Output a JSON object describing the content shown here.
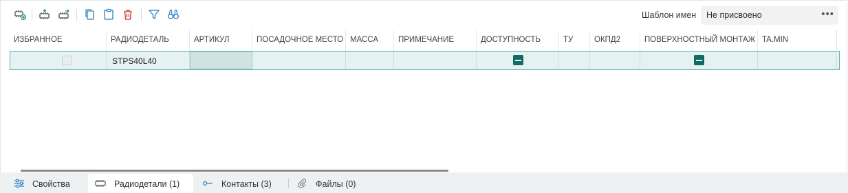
{
  "toolbar": {
    "icons": [
      "add-component-icon",
      "component-import-icon",
      "component-export-icon",
      "copy-icon",
      "paste-icon",
      "delete-icon",
      "filter-icon",
      "binoculars-icon"
    ],
    "colors": {
      "accent": "#2a8a84",
      "delete": "#c0392b"
    }
  },
  "template": {
    "label": "Шаблон имен",
    "value": "Не присвоено",
    "more": "•••"
  },
  "table": {
    "columns": [
      "ИЗБРАННОЕ",
      "РАДИОДЕТАЛЬ",
      "АРТИКУЛ",
      "ПОСАДОЧНОЕ МЕСТО",
      "МАССА",
      "ПРИМЕЧАНИЕ",
      "ДОСТУПНОСТЬ",
      "ТУ",
      "ОКПД2",
      "ПОВЕРХНОСТНЫЙ МОНТАЖ",
      "TA.MIN"
    ],
    "rows": [
      {
        "favorite": false,
        "component": "STPS40L40",
        "article": "",
        "footprint": "",
        "mass": "",
        "note": "",
        "availability": "indeterminate",
        "tu": "",
        "okpd2": "",
        "surface_mount": "indeterminate",
        "ta_min": ""
      }
    ],
    "colors": {
      "row_selected": "#e5f2f1",
      "row_border": "#4fb3ac",
      "indeterminate": "#0f6b64"
    }
  },
  "tabs": [
    {
      "label": "Свойства",
      "icon": "sliders-icon",
      "active": false
    },
    {
      "label": "Радиодетали (1)",
      "icon": "component-icon",
      "active": true
    },
    {
      "label": "Контакты (3)",
      "icon": "pin-icon",
      "active": false
    },
    {
      "label": "Файлы (0)",
      "icon": "paperclip-icon",
      "active": false
    }
  ]
}
